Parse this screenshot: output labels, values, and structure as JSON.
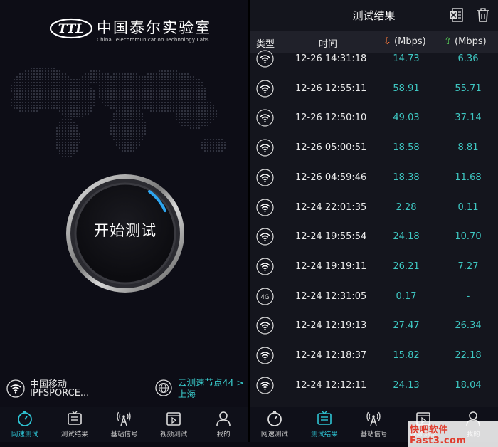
{
  "left": {
    "logo": {
      "cn_text": "中国泰尔实验室",
      "en_text": "China Telecommunication Technology Labs",
      "mark": "TTL"
    },
    "start_button": "开始测试",
    "carrier": "中国移动",
    "ssid": "IPFSPORCE...",
    "node_link": "云测速节点44 > 上海",
    "nav": [
      "网速测试",
      "测试结果",
      "基站信号",
      "视频测试",
      "我的"
    ]
  },
  "right": {
    "title": "测试结果",
    "columns": {
      "type": "类型",
      "time": "时间",
      "down": "(Mbps)",
      "up": "(Mbps)"
    },
    "rows": [
      {
        "net": "wifi",
        "time": "12-26 14:31:18",
        "down": "14.73",
        "up": "6.36"
      },
      {
        "net": "wifi",
        "time": "12-26 12:55:11",
        "down": "58.91",
        "up": "55.71"
      },
      {
        "net": "wifi",
        "time": "12-26 12:50:10",
        "down": "49.03",
        "up": "37.14"
      },
      {
        "net": "wifi",
        "time": "12-26 05:00:51",
        "down": "18.58",
        "up": "8.81"
      },
      {
        "net": "wifi",
        "time": "12-26 04:59:46",
        "down": "18.38",
        "up": "11.68"
      },
      {
        "net": "wifi",
        "time": "12-24 22:01:35",
        "down": "2.28",
        "up": "0.11"
      },
      {
        "net": "wifi",
        "time": "12-24 19:55:54",
        "down": "24.18",
        "up": "10.70"
      },
      {
        "net": "wifi",
        "time": "12-24 19:19:11",
        "down": "26.21",
        "up": "7.27"
      },
      {
        "net": "4G",
        "time": "12-24 12:31:05",
        "down": "0.17",
        "up": "-"
      },
      {
        "net": "wifi",
        "time": "12-24 12:19:13",
        "down": "27.47",
        "up": "26.34"
      },
      {
        "net": "wifi",
        "time": "12-24 12:18:37",
        "down": "15.82",
        "up": "22.18"
      },
      {
        "net": "wifi",
        "time": "12-24 12:12:11",
        "down": "24.13",
        "up": "18.04"
      }
    ],
    "nav": [
      "网速测试",
      "测试结果",
      "基站信号",
      "视频测试",
      "我的"
    ],
    "watermark": "快吧软件 Fast3.com"
  },
  "colors": {
    "accent": "#2ec4d4",
    "value": "#3ec7c2",
    "down_arrow": "#ff7a3c",
    "up_arrow": "#5ad65a"
  },
  "icons": [
    "wifi-icon",
    "4g-icon",
    "globe-icon",
    "stopwatch-icon",
    "results-icon",
    "tower-icon",
    "video-icon",
    "user-icon",
    "excel-icon",
    "trash-icon"
  ]
}
